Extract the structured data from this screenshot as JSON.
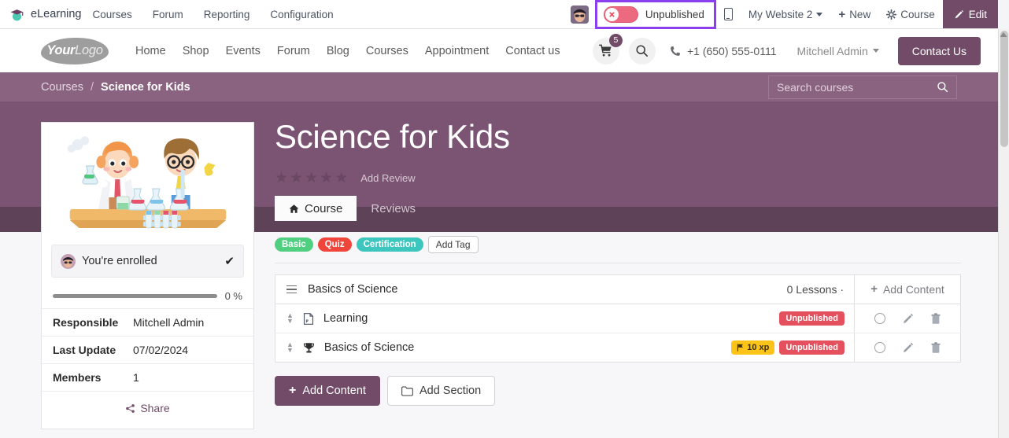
{
  "backend_bar": {
    "app_icon": "graduation-cap-icon",
    "app_name": "eLearning",
    "menu": [
      "Courses",
      "Forum",
      "Reporting",
      "Configuration"
    ],
    "avatar": "user-avatar",
    "publish_toggle": {
      "state_label": "Unpublished",
      "is_published": false,
      "highlight_color": "#8b3ff0",
      "pill_color": "#ec6a80"
    },
    "mobile_preview_icon": "mobile-icon",
    "website_selector": "My Website 2",
    "new_button": "New",
    "object_button": "Course",
    "edit_button": "Edit"
  },
  "site_header": {
    "logo_bold": "Your",
    "logo_light": "Logo",
    "nav": [
      "Home",
      "Shop",
      "Events",
      "Forum",
      "Blog",
      "Courses",
      "Appointment",
      "Contact us"
    ],
    "cart_count": "5",
    "cart_icon": "shopping-cart-icon",
    "search_icon": "search-icon",
    "phone_icon": "phone-icon",
    "phone": "+1 (650) 555-0111",
    "user_name": "Mitchell Admin",
    "contact_button": "Contact Us"
  },
  "breadcrumb": {
    "parent": "Courses",
    "separator": "/",
    "current": "Science for Kids",
    "search_placeholder": "Search courses",
    "search_value": "",
    "search_icon": "search-icon"
  },
  "sidebar": {
    "thumbnail_alt": "two children doing a science experiment with flasks",
    "enrolled_label": "You're enrolled",
    "enrolled_check": "✔",
    "progress_percent": "0 %",
    "progress_value": 0,
    "info_rows": [
      {
        "key": "Responsible",
        "value": "Mitchell Admin"
      },
      {
        "key": "Last Update",
        "value": "07/02/2024"
      },
      {
        "key": "Members",
        "value": "1"
      }
    ],
    "share_label": "Share",
    "share_icon": "share-icon"
  },
  "course": {
    "title": "Science for Kids",
    "rating_stars": 5,
    "rating_filled": 0,
    "add_review": "Add Review",
    "tabs": [
      {
        "label": "Course",
        "icon": "home-icon",
        "active": true
      },
      {
        "label": "Reviews",
        "icon": "",
        "active": false
      }
    ],
    "tags": [
      {
        "label": "Basic",
        "color": "#51cf81"
      },
      {
        "label": "Quiz",
        "color": "#f0453a"
      },
      {
        "label": "Certification",
        "color": "#3cc6bd"
      }
    ],
    "add_tag_label": "Add Tag",
    "section": {
      "drag_icon": "drag-handle-icon",
      "name": "Basics of Science",
      "lesson_count": "0 Lessons ·",
      "add_content_label": "Add Content",
      "add_content_icon": "plus-icon"
    },
    "items": [
      {
        "icon": "document-icon",
        "name": "Learning",
        "xp_badge": "",
        "status_badge": "Unpublished",
        "actions": [
          "circle-icon",
          "pencil-icon",
          "trash-icon"
        ]
      },
      {
        "icon": "trophy-icon",
        "name": "Basics of Science",
        "xp_badge": "10 xp",
        "xp_icon": "flag-icon",
        "status_badge": "Unpublished",
        "actions": [
          "circle-icon",
          "pencil-icon",
          "trash-icon"
        ]
      }
    ],
    "buttons": {
      "add_content": "Add Content",
      "add_content_icon": "plus-icon",
      "add_section": "Add Section",
      "add_section_icon": "folder-icon"
    }
  },
  "colors": {
    "brand_purple": "#714b67",
    "hero": "#7a5472",
    "tabstrip": "#5e4258",
    "breadcrumb": "#8a6380",
    "highlight": "#8b3ff0"
  }
}
